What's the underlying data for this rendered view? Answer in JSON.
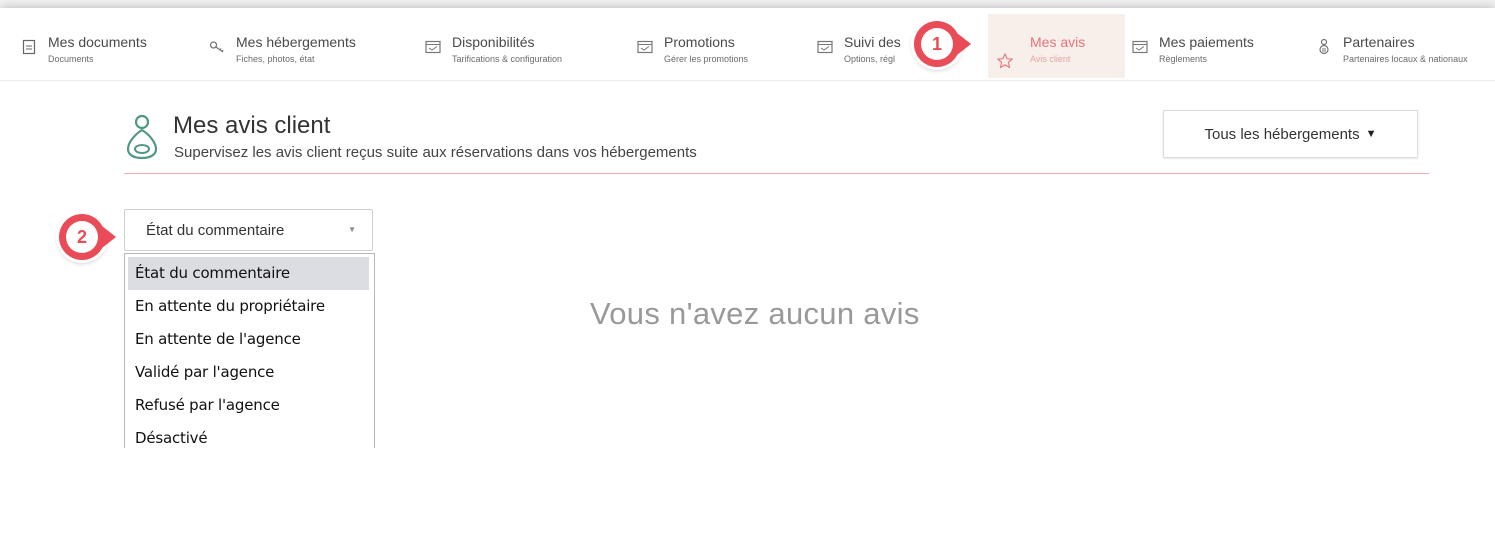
{
  "nav": {
    "items": [
      {
        "label": "Mes documents",
        "sub": "Documents",
        "icon": "document-icon"
      },
      {
        "label": "Mes hébergements",
        "sub": "Fiches, photos, état",
        "icon": "key-icon"
      },
      {
        "label": "Disponibilités",
        "sub": "Tarifications & configuration",
        "icon": "calendar-icon"
      },
      {
        "label": "Promotions",
        "sub": "Gérer les promotions",
        "icon": "calendar-icon"
      },
      {
        "label": "Suivi des",
        "sub": "Options, régl",
        "icon": "calendar-icon"
      },
      {
        "label": "Mes avis",
        "sub": "Avis client",
        "icon": "star-icon",
        "active": true
      },
      {
        "label": "Mes paiements",
        "sub": "Règlements",
        "icon": "calendar-icon"
      },
      {
        "label": "Partenaires",
        "sub": "Partenaires locaux & nationaux",
        "icon": "partners-icon"
      }
    ]
  },
  "badges": {
    "step1": "1",
    "step2": "2"
  },
  "header": {
    "title": "Mes avis client",
    "subtitle": "Supervisez les avis client reçus suite aux réservations dans vos hébergements",
    "accommodations_button": "Tous les hébergements"
  },
  "filter": {
    "selected": "État du commentaire",
    "options": [
      "État du commentaire",
      "En attente du propriétaire",
      "En attente de l'agence",
      "Validé par l'agence",
      "Refusé par l'agence",
      "Désactivé"
    ]
  },
  "empty_message": "Vous n'avez aucun avis",
  "colors": {
    "accent": "#e8727a",
    "badge": "#e94c57",
    "icon_green": "#4f9a7e",
    "active_bg": "#f7efe9"
  }
}
